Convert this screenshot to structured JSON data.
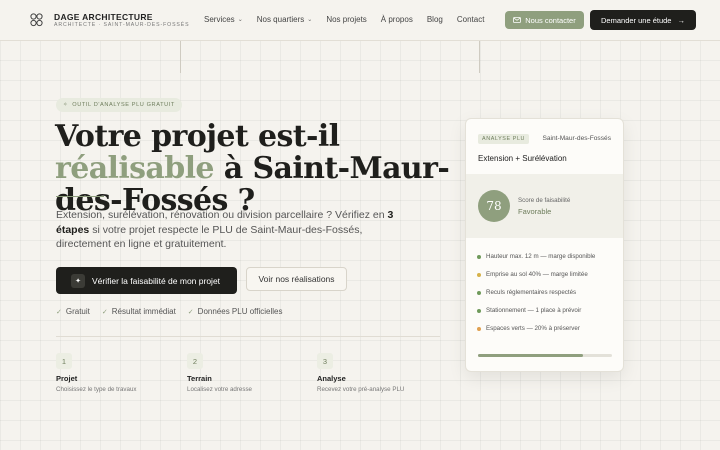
{
  "brand": {
    "name": "DAGE ARCHITECTURE",
    "subtitle": "ARCHITECTE · SAINT-MAUR-DES-FOSSÉS"
  },
  "nav": {
    "items": [
      {
        "label": "Services",
        "dropdown": true
      },
      {
        "label": "Nos quartiers",
        "dropdown": true
      },
      {
        "label": "Nos projets",
        "dropdown": false
      },
      {
        "label": "À propos",
        "dropdown": false
      },
      {
        "label": "Blog",
        "dropdown": false
      },
      {
        "label": "Contact",
        "dropdown": false
      }
    ],
    "contact_button": "Nous contacter",
    "study_button": "Demander une étude"
  },
  "hero": {
    "badge": "OUTIL D'ANALYSE PLU GRATUIT",
    "title_part1": "Votre projet est-il ",
    "title_accent": "réalisable",
    "title_part2": " à Saint-Maur-des-Fossés ?",
    "desc_part1": "Extension, surélévation, rénovation ou division parcellaire ? Vérifiez en ",
    "desc_bold": "3 étapes",
    "desc_part2": " si votre projet respecte le PLU de Saint-Maur-des-Fossés, directement en ligne et gratuitement.",
    "primary_button": "Vérifier la faisabilité de mon projet",
    "secondary_button": "Voir nos réalisations",
    "checks": [
      "Gratuit",
      "Résultat immédiat",
      "Données PLU officielles"
    ]
  },
  "steps": [
    {
      "num": "1",
      "title": "Projet",
      "desc": "Choisissez le type de travaux"
    },
    {
      "num": "2",
      "title": "Terrain",
      "desc": "Localisez votre adresse"
    },
    {
      "num": "3",
      "title": "Analyse",
      "desc": "Recevez votre pré-analyse PLU"
    }
  ],
  "card": {
    "tag": "ANALYSE PLU",
    "location": "Saint-Maur-des-Fossés",
    "title": "Extension + Surélévation",
    "score": "78",
    "score_label": "Score de faisabilité",
    "score_status": "Favorable",
    "criteria": [
      {
        "text": "Hauteur max. 12 m — marge disponible",
        "color": "#6f9a5b"
      },
      {
        "text": "Emprise au sol 40% — marge limitée",
        "color": "#d6b24a"
      },
      {
        "text": "Reculs réglementaires respectés",
        "color": "#6f9a5b"
      },
      {
        "text": "Stationnement — 1 place à prévoir",
        "color": "#6f9a5b"
      },
      {
        "text": "Espaces verts — 20% à préserver",
        "color": "#e0a050"
      }
    ],
    "progress": 0.78
  },
  "colors": {
    "accent": "#8f9f7e",
    "dark": "#1f1f1c",
    "background": "#f5f3ee"
  }
}
